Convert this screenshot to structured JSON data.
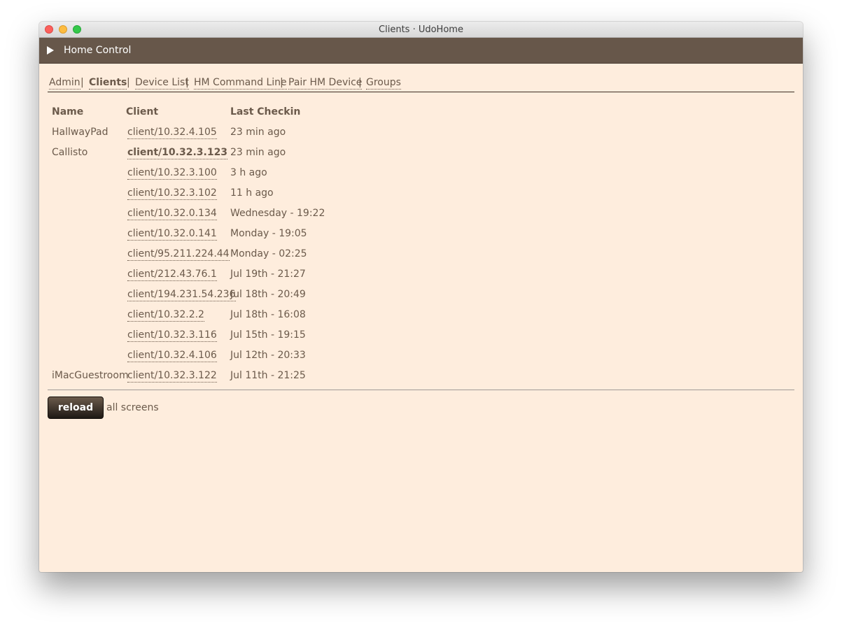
{
  "window": {
    "title": "Clients · UdoHome"
  },
  "appbar": {
    "title": "Home Control"
  },
  "nav": {
    "items": [
      "Admin",
      "Clients",
      "Device List",
      "HM Command Line",
      "Pair HM Device",
      "Groups"
    ],
    "active": "Clients",
    "separator": "|"
  },
  "table": {
    "headers": {
      "name": "Name",
      "client": "Client",
      "last_checkin": "Last Checkin"
    },
    "rows": [
      {
        "name": "HallwayPad",
        "client": "client/10.32.4.105",
        "last_checkin": "23 min ago"
      },
      {
        "name": "Callisto",
        "client": "client/10.32.3.123",
        "last_checkin": "23 min ago",
        "current": true
      },
      {
        "name": "",
        "client": "client/10.32.3.100",
        "last_checkin": "3 h ago"
      },
      {
        "name": "",
        "client": "client/10.32.3.102",
        "last_checkin": "11 h ago"
      },
      {
        "name": "",
        "client": "client/10.32.0.134",
        "last_checkin": "Wednesday - 19:22"
      },
      {
        "name": "",
        "client": "client/10.32.0.141",
        "last_checkin": "Monday - 19:05"
      },
      {
        "name": "",
        "client": "client/95.211.224.44",
        "last_checkin": "Monday - 02:25"
      },
      {
        "name": "",
        "client": "client/212.43.76.1",
        "last_checkin": "Jul 19th - 21:27"
      },
      {
        "name": "",
        "client": "client/194.231.54.236",
        "last_checkin": "Jul 18th - 20:49"
      },
      {
        "name": "",
        "client": "client/10.32.2.2",
        "last_checkin": "Jul 18th - 16:08"
      },
      {
        "name": "",
        "client": "client/10.32.3.116",
        "last_checkin": "Jul 15th - 19:15"
      },
      {
        "name": "",
        "client": "client/10.32.4.106",
        "last_checkin": "Jul 12th - 20:33"
      },
      {
        "name": "iMacGuestroom",
        "client": "client/10.32.3.122",
        "last_checkin": "Jul 11th - 21:25"
      }
    ]
  },
  "actions": {
    "reload_label": "reload",
    "reload_note": "all screens"
  },
  "colors": {
    "background": "#feeddd",
    "appbar": "#67574a",
    "text": "#6b5a4b",
    "button_dark": "#1e1814"
  }
}
